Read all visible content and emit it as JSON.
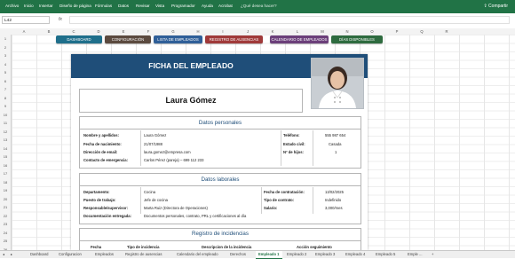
{
  "ribbon": {
    "menu": [
      "Archivo",
      "Inicio",
      "Insertar",
      "Diseño de página",
      "Fórmulas",
      "Datos",
      "Revisar",
      "Vista",
      "Programador",
      "Ayuda",
      "Acrobat",
      "¿Qué desea hacer?"
    ],
    "share": "Compartir"
  },
  "formula_bar": {
    "cell_ref": "L42",
    "fx": "fx",
    "value": ""
  },
  "columns": [
    "A",
    "B",
    "C",
    "D",
    "E",
    "F",
    "G",
    "H",
    "I",
    "J",
    "K",
    "L",
    "M",
    "N",
    "O",
    "P",
    "Q",
    "R"
  ],
  "rows": [
    "1",
    "2",
    "3",
    "4",
    "5",
    "6",
    "7",
    "8",
    "9",
    "10",
    "11",
    "12",
    "13",
    "14",
    "15",
    "16",
    "17",
    "18",
    "19",
    "20",
    "21",
    "22",
    "23",
    "24",
    "25",
    "26"
  ],
  "nav": [
    {
      "label": "DASHBOARD",
      "color": "#1f6f8b"
    },
    {
      "label": "CONFIGURACIÓN",
      "color": "#5b4a3f"
    },
    {
      "label": "LISTA DE EMPLEADOS",
      "color": "#2f5f98"
    },
    {
      "label": "REGISTRO DE AUSENCIAS",
      "color": "#a03a3a"
    },
    {
      "label": "CALENDARIO DE EMPLEADOS",
      "color": "#6b3f7a"
    },
    {
      "label": "DÍAS DISPONIBLES",
      "color": "#2e6b3f"
    }
  ],
  "card": {
    "title": "FICHA DEL EMPLEADO",
    "employee_name": "Laura Gómez"
  },
  "personal": {
    "title": "Datos personales",
    "rows": [
      {
        "label": "Nombre y apellidos:",
        "value": "Laura Gómez",
        "label2": "Teléfono:",
        "value2": "555 987 654"
      },
      {
        "label": "Fecha de nacimiento:",
        "value": "21/07/1988",
        "label2": "Estado civil:",
        "value2": "Casada"
      },
      {
        "label": "Dirección de email:",
        "value": "laura.gomez@empresa.com",
        "label2": "Nº de hijos:",
        "value2": "1"
      },
      {
        "label": "Contacto de emergencia:",
        "value": "Carlos Pérez (pareja) – 699 112 233",
        "label2": "",
        "value2": ""
      }
    ]
  },
  "work": {
    "title": "Datos laborales",
    "rows": [
      {
        "label": "Departamento:",
        "value": "Cocina",
        "label2": "Fecha de contratación:",
        "value2": "13/02/2025"
      },
      {
        "label": "Puesto de trabajo:",
        "value": "Jefe de cocina",
        "label2": "Tipo de contrato:",
        "value2": "Indefinido"
      },
      {
        "label": "Responsable/supervisor:",
        "value": "Marta Ruiz (Directora de Operaciones)",
        "label2": "Salario:",
        "value2": "3,000/mes"
      },
      {
        "label": "Documentación entregada:",
        "value": "Documentos personales, contrato, PRL y certificaciones al día",
        "label2": "",
        "value2": ""
      }
    ]
  },
  "incidents": {
    "title": "Registro de incidencias",
    "headers": [
      "Fecha",
      "Tipo de incidencia",
      "Descripcion de la incidencia",
      "Acción seguimiento"
    ]
  },
  "tabs": [
    {
      "label": "Dashboard",
      "active": false
    },
    {
      "label": "Configuracion",
      "active": false
    },
    {
      "label": "Empleados",
      "active": false
    },
    {
      "label": "Registro de ausencias",
      "active": false
    },
    {
      "label": "Calendario del empleado",
      "active": false
    },
    {
      "label": "Derechos",
      "active": false
    },
    {
      "label": "Empleado 1",
      "active": true
    },
    {
      "label": "Empleado 2",
      "active": false
    },
    {
      "label": "Empleado 3",
      "active": false
    },
    {
      "label": "Empleado 4",
      "active": false
    },
    {
      "label": "Empleado 5",
      "active": false
    },
    {
      "label": "Emple ...",
      "active": false
    }
  ],
  "tab_controls": {
    "prev": "◂",
    "next": "▸",
    "add": "+"
  }
}
